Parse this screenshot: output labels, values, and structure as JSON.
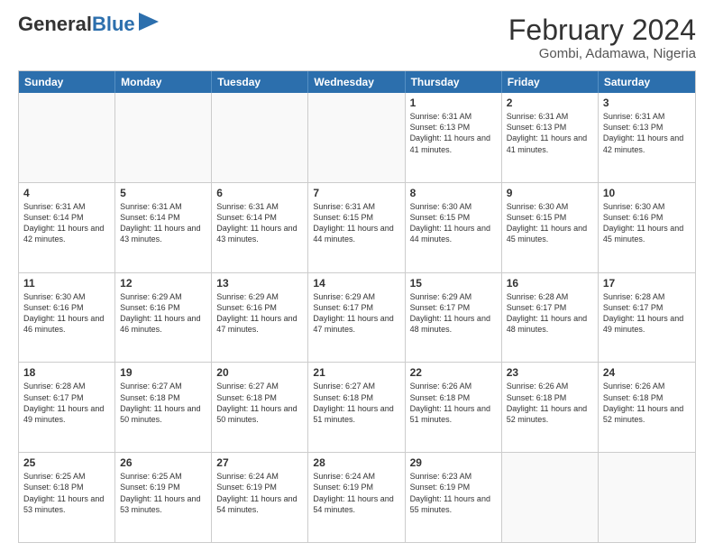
{
  "header": {
    "logo_line1": "General",
    "logo_line2": "Blue",
    "title": "February 2024",
    "subtitle": "Gombi, Adamawa, Nigeria"
  },
  "days_of_week": [
    "Sunday",
    "Monday",
    "Tuesday",
    "Wednesday",
    "Thursday",
    "Friday",
    "Saturday"
  ],
  "weeks": [
    [
      {
        "day": "",
        "info": ""
      },
      {
        "day": "",
        "info": ""
      },
      {
        "day": "",
        "info": ""
      },
      {
        "day": "",
        "info": ""
      },
      {
        "day": "1",
        "info": "Sunrise: 6:31 AM\nSunset: 6:13 PM\nDaylight: 11 hours and 41 minutes."
      },
      {
        "day": "2",
        "info": "Sunrise: 6:31 AM\nSunset: 6:13 PM\nDaylight: 11 hours and 41 minutes."
      },
      {
        "day": "3",
        "info": "Sunrise: 6:31 AM\nSunset: 6:13 PM\nDaylight: 11 hours and 42 minutes."
      }
    ],
    [
      {
        "day": "4",
        "info": "Sunrise: 6:31 AM\nSunset: 6:14 PM\nDaylight: 11 hours and 42 minutes."
      },
      {
        "day": "5",
        "info": "Sunrise: 6:31 AM\nSunset: 6:14 PM\nDaylight: 11 hours and 43 minutes."
      },
      {
        "day": "6",
        "info": "Sunrise: 6:31 AM\nSunset: 6:14 PM\nDaylight: 11 hours and 43 minutes."
      },
      {
        "day": "7",
        "info": "Sunrise: 6:31 AM\nSunset: 6:15 PM\nDaylight: 11 hours and 44 minutes."
      },
      {
        "day": "8",
        "info": "Sunrise: 6:30 AM\nSunset: 6:15 PM\nDaylight: 11 hours and 44 minutes."
      },
      {
        "day": "9",
        "info": "Sunrise: 6:30 AM\nSunset: 6:15 PM\nDaylight: 11 hours and 45 minutes."
      },
      {
        "day": "10",
        "info": "Sunrise: 6:30 AM\nSunset: 6:16 PM\nDaylight: 11 hours and 45 minutes."
      }
    ],
    [
      {
        "day": "11",
        "info": "Sunrise: 6:30 AM\nSunset: 6:16 PM\nDaylight: 11 hours and 46 minutes."
      },
      {
        "day": "12",
        "info": "Sunrise: 6:29 AM\nSunset: 6:16 PM\nDaylight: 11 hours and 46 minutes."
      },
      {
        "day": "13",
        "info": "Sunrise: 6:29 AM\nSunset: 6:16 PM\nDaylight: 11 hours and 47 minutes."
      },
      {
        "day": "14",
        "info": "Sunrise: 6:29 AM\nSunset: 6:17 PM\nDaylight: 11 hours and 47 minutes."
      },
      {
        "day": "15",
        "info": "Sunrise: 6:29 AM\nSunset: 6:17 PM\nDaylight: 11 hours and 48 minutes."
      },
      {
        "day": "16",
        "info": "Sunrise: 6:28 AM\nSunset: 6:17 PM\nDaylight: 11 hours and 48 minutes."
      },
      {
        "day": "17",
        "info": "Sunrise: 6:28 AM\nSunset: 6:17 PM\nDaylight: 11 hours and 49 minutes."
      }
    ],
    [
      {
        "day": "18",
        "info": "Sunrise: 6:28 AM\nSunset: 6:17 PM\nDaylight: 11 hours and 49 minutes."
      },
      {
        "day": "19",
        "info": "Sunrise: 6:27 AM\nSunset: 6:18 PM\nDaylight: 11 hours and 50 minutes."
      },
      {
        "day": "20",
        "info": "Sunrise: 6:27 AM\nSunset: 6:18 PM\nDaylight: 11 hours and 50 minutes."
      },
      {
        "day": "21",
        "info": "Sunrise: 6:27 AM\nSunset: 6:18 PM\nDaylight: 11 hours and 51 minutes."
      },
      {
        "day": "22",
        "info": "Sunrise: 6:26 AM\nSunset: 6:18 PM\nDaylight: 11 hours and 51 minutes."
      },
      {
        "day": "23",
        "info": "Sunrise: 6:26 AM\nSunset: 6:18 PM\nDaylight: 11 hours and 52 minutes."
      },
      {
        "day": "24",
        "info": "Sunrise: 6:26 AM\nSunset: 6:18 PM\nDaylight: 11 hours and 52 minutes."
      }
    ],
    [
      {
        "day": "25",
        "info": "Sunrise: 6:25 AM\nSunset: 6:18 PM\nDaylight: 11 hours and 53 minutes."
      },
      {
        "day": "26",
        "info": "Sunrise: 6:25 AM\nSunset: 6:19 PM\nDaylight: 11 hours and 53 minutes."
      },
      {
        "day": "27",
        "info": "Sunrise: 6:24 AM\nSunset: 6:19 PM\nDaylight: 11 hours and 54 minutes."
      },
      {
        "day": "28",
        "info": "Sunrise: 6:24 AM\nSunset: 6:19 PM\nDaylight: 11 hours and 54 minutes."
      },
      {
        "day": "29",
        "info": "Sunrise: 6:23 AM\nSunset: 6:19 PM\nDaylight: 11 hours and 55 minutes."
      },
      {
        "day": "",
        "info": ""
      },
      {
        "day": "",
        "info": ""
      }
    ]
  ]
}
